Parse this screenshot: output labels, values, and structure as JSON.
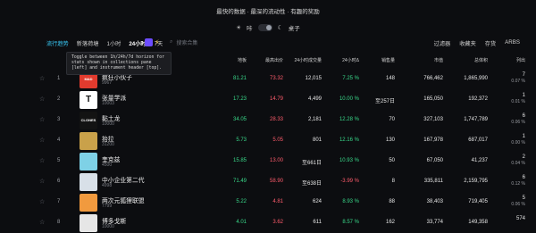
{
  "banner": "最快的数据 · 最深的流动性 · 有趣的奖励",
  "theme": {
    "left_label": "咔",
    "right_label": "桌子"
  },
  "tabs": [
    {
      "label": "流行趋势",
      "state": "active"
    },
    {
      "label": "新落荷塘",
      "state": ""
    },
    {
      "label": "1小时",
      "state": ""
    },
    {
      "label": "24小时",
      "state": "bold"
    },
    {
      "label": "7天",
      "state": ""
    }
  ],
  "search": {
    "placeholder": "搜索合集"
  },
  "right_tools": [
    "过滤器",
    "收藏夹",
    "存货",
    "ARBS"
  ],
  "tooltip": "Toggle between 1h/24h/7d horizon for stats shown in collections pane [left] and instrument header [top].",
  "headers": {
    "floor": "地板",
    "top_bid": "最高出价",
    "vol24": "24小时成交量",
    "chg24": "24小时Δ",
    "sales": "销售量",
    "mcap": "市值",
    "total_vol": "总体积",
    "listed": "列出"
  },
  "rows": [
    {
      "rank": "1",
      "name": "疯狂小伙子",
      "supply": "9967",
      "floor": "81.21",
      "bid": "73.32",
      "vol": "12,015",
      "chg": "7.25 %",
      "chg_dir": "up",
      "sales": "148",
      "mcap": "766,462",
      "total": "1,865,990",
      "listed": "7",
      "listed_pct": "0.07 %",
      "logo_color": "#e23b2e",
      "logo_text": "MAD LADS",
      "bid_dir": "down"
    },
    {
      "rank": "2",
      "name": "张量学派",
      "supply": "10003",
      "floor": "17.23",
      "bid": "14.79",
      "vol": "4,499",
      "chg": "10.00 %",
      "chg_dir": "up",
      "sales": "至257日",
      "mcap": "165,050",
      "total": "192,372",
      "listed": "1",
      "listed_pct": "0.01 %",
      "logo_color": "#ffffff",
      "logo_text": "T",
      "bid_dir": "down"
    },
    {
      "rank": "3",
      "name": "黏土龙",
      "supply": "10000",
      "floor": "34.05",
      "bid": "28.33",
      "vol": "2,181",
      "chg": "12.28 %",
      "chg_dir": "up",
      "sales": "70",
      "mcap": "327,103",
      "total": "1,747,789",
      "listed": "6",
      "listed_pct": "0.06 %",
      "logo_color": "#131313",
      "logo_text": "CLONES",
      "bid_dir": "down"
    },
    {
      "rank": "4",
      "name": "抬拉",
      "supply": "31200",
      "floor": "5.73",
      "bid": "5.05",
      "vol": "801",
      "chg": "12.16 %",
      "chg_dir": "up",
      "sales": "130",
      "mcap": "167,978",
      "total": "687,017",
      "listed": "1",
      "listed_pct": "0.00 %",
      "logo_color": "#c9a14a",
      "logo_text": "",
      "bid_dir": "down"
    },
    {
      "rank": "5",
      "name": "奎克兹",
      "supply": "4500",
      "floor": "15.85",
      "bid": "13.00",
      "vol": "至661日",
      "chg": "10.93 %",
      "chg_dir": "up",
      "sales": "50",
      "mcap": "67,050",
      "total": "41,237",
      "listed": "2",
      "listed_pct": "0.04 %",
      "logo_color": "#7ed1e6",
      "logo_text": "",
      "bid_dir": "down"
    },
    {
      "rank": "6",
      "name": "中小企业第二代",
      "supply": "4998",
      "floor": "71.49",
      "bid": "58.90",
      "vol": "至638日",
      "chg": "-3.99 %",
      "chg_dir": "down",
      "sales": "8",
      "mcap": "335,811",
      "total": "2,159,795",
      "listed": "6",
      "listed_pct": "0.12 %",
      "logo_color": "#d8e0e8",
      "logo_text": "",
      "bid_dir": "down"
    },
    {
      "rank": "7",
      "name": "两次元狐狸联盟",
      "supply": "7799",
      "floor": "5.22",
      "bid": "4.81",
      "vol": "624",
      "chg": "8.93 %",
      "chg_dir": "up",
      "sales": "88",
      "mcap": "38,403",
      "total": "719,405",
      "listed": "5",
      "listed_pct": "0.06 %",
      "logo_color": "#f19a3e",
      "logo_text": "",
      "bid_dir": "down"
    },
    {
      "rank": "8",
      "name": "博多戈斯",
      "supply": "10000",
      "floor": "4.01",
      "bid": "3.62",
      "vol": "611",
      "chg": "8.57 %",
      "chg_dir": "up",
      "sales": "162",
      "mcap": "33,774",
      "total": "149,358",
      "listed": "574",
      "listed_pct": "",
      "logo_color": "#e6e6e6",
      "logo_text": "",
      "bid_dir": "down"
    }
  ]
}
